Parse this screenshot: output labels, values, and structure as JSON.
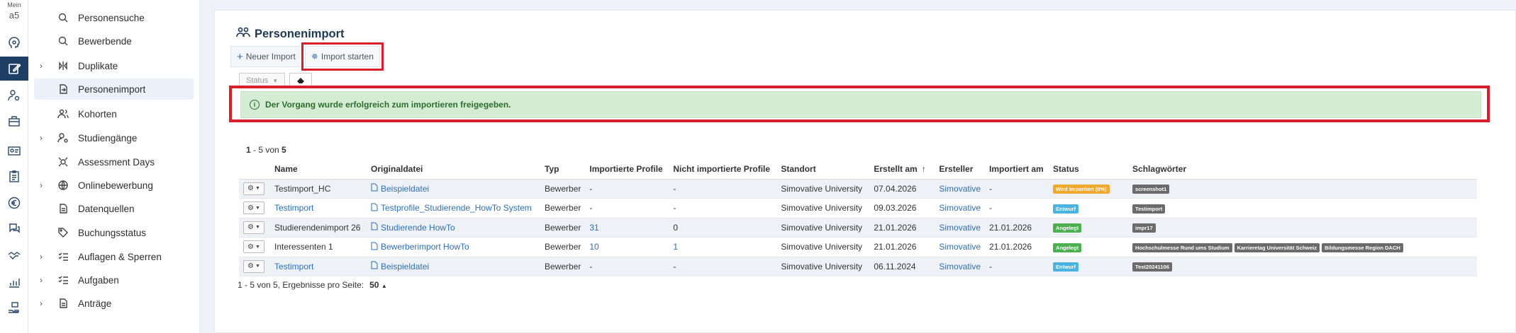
{
  "brand": {
    "line1": "Mein",
    "line2": "a5"
  },
  "rail_icons": [
    "head-icon",
    "edit-icon",
    "users-gear-icon",
    "briefcase-icon",
    "id-card-icon",
    "clipboard-icon",
    "euro-icon",
    "chat-icon",
    "handshake-icon",
    "chart-icon",
    "hand-coin-icon"
  ],
  "nav": {
    "items": [
      {
        "label": "Personensuche",
        "icon": "search-icon",
        "expandable": false
      },
      {
        "label": "Bewerbende",
        "icon": "search-icon",
        "expandable": false
      },
      {
        "label": "Duplikate",
        "icon": "compare-icon",
        "expandable": true
      },
      {
        "label": "Personenimport",
        "icon": "file-import-icon",
        "expandable": false,
        "active": true
      },
      {
        "label": "Kohorten",
        "icon": "users-icon",
        "expandable": false
      },
      {
        "label": "Studiengänge",
        "icon": "user-settings-icon",
        "expandable": true
      },
      {
        "label": "Assessment Days",
        "icon": "target-icon",
        "expandable": false
      },
      {
        "label": "Onlinebewerbung",
        "icon": "globe-icon",
        "expandable": true
      },
      {
        "label": "Datenquellen",
        "icon": "document-icon",
        "expandable": false
      },
      {
        "label": "Buchungsstatus",
        "icon": "tag-icon",
        "expandable": false
      },
      {
        "label": "Auflagen & Sperren",
        "icon": "checklist-icon",
        "expandable": true
      },
      {
        "label": "Aufgaben",
        "icon": "checklist-icon",
        "expandable": true
      },
      {
        "label": "Anträge",
        "icon": "document-icon",
        "expandable": true
      }
    ]
  },
  "page": {
    "title": "Personenimport",
    "toolbar": {
      "new_import": "Neuer Import",
      "start_import": "Import starten"
    },
    "filters": {
      "status_label": "Status"
    },
    "alert": {
      "text": "Der Vorgang wurde erfolgreich zum importieren freigegeben."
    },
    "count_top": {
      "range": "1",
      "rest": " - 5 von ",
      "total": "5"
    },
    "count_bottom": {
      "text": "1 - 5 von 5, Ergebnisse pro Seite:",
      "per_page": "50"
    }
  },
  "colors": {
    "brand_dark": "#1d3f63",
    "link": "#2e6fb6",
    "highlight": "#d9202a",
    "alert_bg": "#d5ecd4",
    "badge_orange": "#f0a830",
    "badge_blue": "#4ab3e0",
    "badge_green": "#4caf50",
    "tag_gray": "#6b6b6b"
  },
  "table": {
    "columns": [
      "",
      "Name",
      "Originaldatei",
      "Typ",
      "Importierte Profile",
      "Nicht importierte Profile",
      "Standort",
      "Erstellt am",
      "Ersteller",
      "Importiert am",
      "Status",
      "Schlagwörter"
    ],
    "rows": [
      {
        "name": "Testimport_HC",
        "name_link": false,
        "file": "Beispieldatei",
        "typ": "Bewerber",
        "imported": "-",
        "imported_link": false,
        "not_imported": "-",
        "not_imported_link": false,
        "standort": "Simovative University",
        "erstellt": "07.04.2026",
        "ersteller": "Simovative",
        "importiert": "-",
        "status": "Wird importiert (0%)",
        "status_color": "#f0a830",
        "tags": [
          "screenshot1"
        ]
      },
      {
        "name": "Testimport",
        "name_link": true,
        "file": "Testprofile_Studierende_HowTo System",
        "typ": "Bewerber",
        "imported": "-",
        "imported_link": false,
        "not_imported": "-",
        "not_imported_link": false,
        "standort": "Simovative University",
        "erstellt": "09.03.2026",
        "ersteller": "Simovative",
        "importiert": "-",
        "status": "Entwurf",
        "status_color": "#4ab3e0",
        "tags": [
          "Testimport"
        ]
      },
      {
        "name": "Studierendenimport 26",
        "name_link": false,
        "file": "Studierende HowTo",
        "typ": "Bewerber",
        "imported": "31",
        "imported_link": true,
        "not_imported": "0",
        "not_imported_link": false,
        "standort": "Simovative University",
        "erstellt": "21.01.2026",
        "ersteller": "Simovative",
        "importiert": "21.01.2026",
        "status": "Angelegt",
        "status_color": "#4caf50",
        "tags": [
          "impr17"
        ]
      },
      {
        "name": "Interessenten 1",
        "name_link": false,
        "file": "Bewerberimport HowTo",
        "typ": "Bewerber",
        "imported": "10",
        "imported_link": true,
        "not_imported": "1",
        "not_imported_link": true,
        "standort": "Simovative University",
        "erstellt": "21.01.2026",
        "ersteller": "Simovative",
        "importiert": "21.01.2026",
        "status": "Angelegt",
        "status_color": "#4caf50",
        "tags": [
          "Hochschulmesse Rund ums Studium",
          "Karrieretag Universität Schweiz",
          "Bildungsmesse Region DACH"
        ]
      },
      {
        "name": "Testimport",
        "name_link": true,
        "file": "Beispieldatei",
        "typ": "Bewerber",
        "imported": "-",
        "imported_link": false,
        "not_imported": "-",
        "not_imported_link": false,
        "standort": "Simovative University",
        "erstellt": "06.11.2024",
        "ersteller": "Simovative",
        "importiert": "-",
        "status": "Entwurf",
        "status_color": "#4ab3e0",
        "tags": [
          "Test20241106"
        ]
      }
    ]
  }
}
